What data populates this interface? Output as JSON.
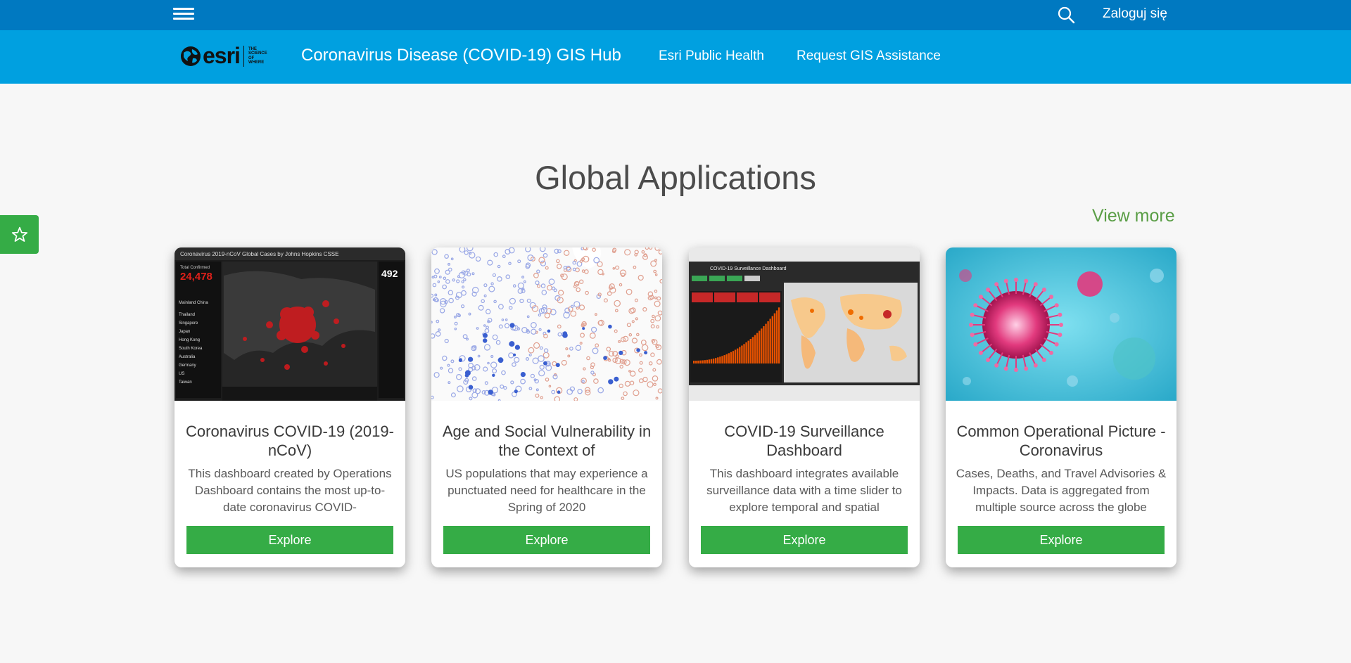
{
  "topbar": {
    "login_label": "Zaloguj się"
  },
  "navbar": {
    "hub_title": "Coronavirus Disease (COVID-19) GIS Hub",
    "links": [
      "Esri Public Health",
      "Request GIS Assistance"
    ]
  },
  "logo": {
    "word": "esri",
    "tagline": "THE SCIENCE OF WHERE"
  },
  "section": {
    "title": "Global Applications",
    "view_more": "View more"
  },
  "favorite": {
    "icon": "star-outline-icon"
  },
  "cards": [
    {
      "title": "Coronavirus COVID-19 (2019-nCoV)",
      "desc": "This dashboard created by Operations Dashboard contains the most up-to-date coronavirus COVID-",
      "button": "Explore",
      "thumb": {
        "header": "Coronavirus 2019-nCoV Global Cases by Johns Hopkins CSSE",
        "total_label": "Total Confirmed",
        "total": "24,478",
        "side_number": "492",
        "countries": [
          "Mainland China",
          "Thailand",
          "Singapore",
          "Japan",
          "Hong Kong",
          "South Korea",
          "Australia",
          "Germany",
          "US",
          "Taiwan"
        ]
      }
    },
    {
      "title": "Age and Social Vulnerability in the Context of",
      "desc": "US populations that may experience a punctuated need for healthcare in the Spring of 2020",
      "button": "Explore"
    },
    {
      "title": "COVID-19 Surveillance Dashboard",
      "desc": "This dashboard integrates available surveillance data with a time slider to explore temporal and spatial",
      "button": "Explore",
      "thumb": {
        "header": "COVID-19 Surveillance Dashboard"
      }
    },
    {
      "title": "Common Operational Picture - Coronavirus",
      "desc": "Cases, Deaths, and Travel Advisories & Impacts. Data is aggregated from multiple source across the globe",
      "button": "Explore"
    }
  ],
  "colors": {
    "topbar": "#0079c1",
    "navbar": "#00a0e0",
    "accent_green": "#35ac46",
    "view_more_green": "#5a9e46"
  }
}
